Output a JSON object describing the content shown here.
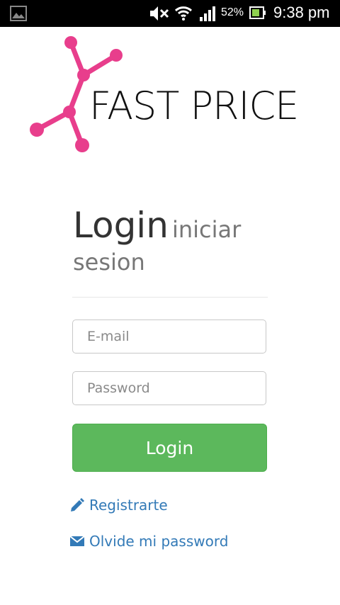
{
  "status_bar": {
    "battery_percent": "52%",
    "time": "9:38 pm",
    "icons": [
      "image-notification-icon",
      "mute-icon",
      "wifi-icon",
      "signal-icon",
      "battery-icon"
    ]
  },
  "logo": {
    "text": "FAST PRICE",
    "mark_color": "#e83e8c"
  },
  "heading": {
    "main": "Login",
    "sub": "iniciar sesion"
  },
  "form": {
    "email_placeholder": "E-mail",
    "password_placeholder": "Password",
    "submit_label": "Login"
  },
  "links": {
    "register_label": "Registrarte",
    "forgot_label": "Olvide mi password"
  },
  "colors": {
    "primary_button": "#5cb85c",
    "link": "#337ab7"
  }
}
